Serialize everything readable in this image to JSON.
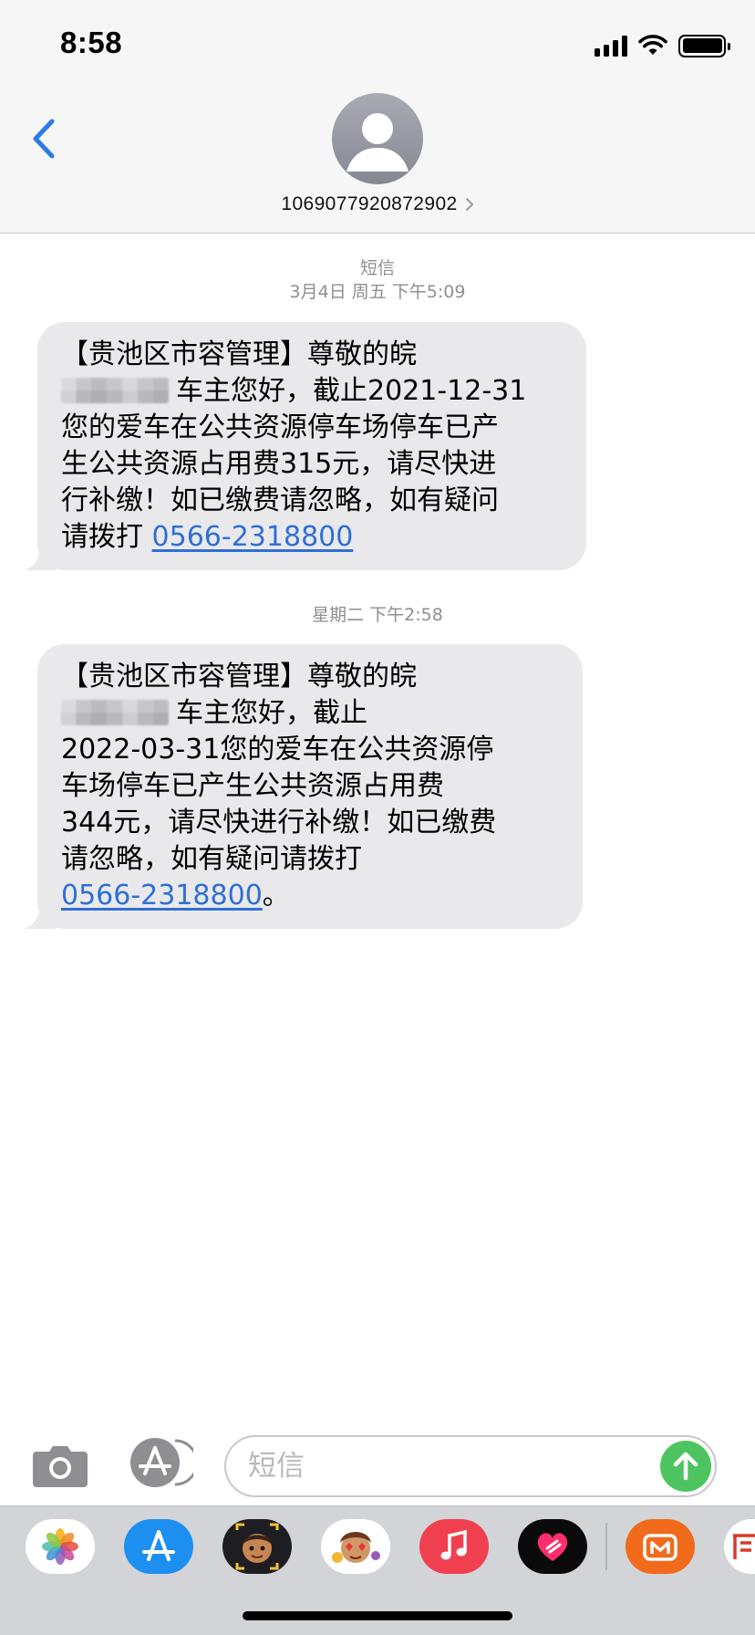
{
  "status_bar": {
    "time": "8:58"
  },
  "header": {
    "contact_number": "1069077920872902",
    "back_icon": "chevron-left-icon",
    "accent_color": "#2f7be5"
  },
  "conversation": {
    "service_label": "短信",
    "first_timestamp": "3月4日 周五 下午5:09",
    "second_timestamp": "星期二 下午2:58",
    "message1": {
      "line1": "【贵池区市容管理】尊敬的皖",
      "line2": "车主您好，截止2021-12-31",
      "line3": "您的爱车在公共资源停车场停车已产",
      "line4": "生公共资源占用费315元，请尽快进",
      "line5": "行补缴！如已缴费请忽略，如有疑问",
      "line6": "请拨打",
      "phone": "0566-2318800"
    },
    "message2": {
      "line1": "【贵池区市容管理】尊敬的皖",
      "line2": "车主您好，截止",
      "line3": "2022-03-31您的爱车在公共资源停",
      "line4": "车场停车已产生公共资源占用费",
      "line5": "344元，请尽快进行补缴！如已缴费",
      "line6": "请忽略，如有疑问请拨打",
      "phone": "0566-2318800",
      "ending": "。"
    }
  },
  "input_bar": {
    "placeholder": "短信",
    "camera_icon": "camera-icon",
    "apps_icon": "app-store-icon",
    "send_icon": "send-arrow-icon",
    "send_color": "#4ec461"
  },
  "app_drawer": {
    "apps": [
      "photos-icon",
      "app-store-icon",
      "memoji-icon",
      "animoji-icon",
      "music-icon",
      "fitness-heart-icon",
      "mango-tv-icon",
      "partial-app-icon"
    ]
  }
}
